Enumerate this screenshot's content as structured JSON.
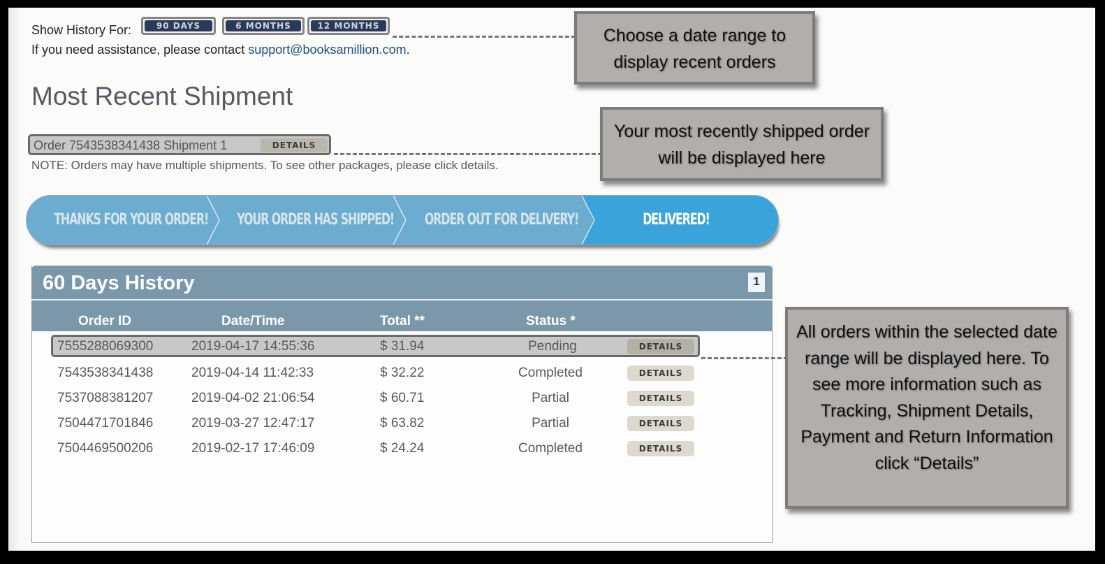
{
  "history_bar": {
    "label": "Show History For:",
    "buttons": [
      "90 DAYS",
      "6 MONTHS",
      "12 MONTHS"
    ]
  },
  "assistance": {
    "prefix": "If you need assistance, please contact ",
    "email": "support@booksamillion.com",
    "suffix": "."
  },
  "recent_shipment": {
    "title": "Most Recent Shipment",
    "order_text": "Order 7543538341438 Shipment 1",
    "details_label": "DETAILS",
    "note": "NOTE: Orders may have multiple shipments. To see other packages, please click details."
  },
  "progress": {
    "steps": [
      "THANKS FOR YOUR ORDER!",
      "YOUR ORDER HAS SHIPPED!",
      "ORDER OUT FOR DELIVERY!",
      "DELIVERED!"
    ],
    "current_step": "DELIVERED!",
    "colors": {
      "inactive": "#6baccf",
      "active": "#3aa3d9"
    }
  },
  "history_panel": {
    "title": "60 Days History",
    "page": "1",
    "columns": [
      "Order ID",
      "Date/Time",
      "Total **",
      "Status *"
    ],
    "details_label": "DETAILS",
    "rows": [
      {
        "order_id": "7555288069300",
        "datetime": "2019-04-17 14:55:36",
        "total": "$ 31.94",
        "status": "Pending",
        "highlighted": true
      },
      {
        "order_id": "7543538341438",
        "datetime": "2019-04-14 11:42:33",
        "total": "$ 32.22",
        "status": "Completed"
      },
      {
        "order_id": "7537088381207",
        "datetime": "2019-04-02 21:06:54",
        "total": "$ 60.71",
        "status": "Partial"
      },
      {
        "order_id": "7504471701846",
        "datetime": "2019-03-27 12:47:17",
        "total": "$ 63.82",
        "status": "Partial"
      },
      {
        "order_id": "7504469500206",
        "datetime": "2019-02-17 17:46:09",
        "total": "$ 24.24",
        "status": "Completed"
      }
    ],
    "header_color": "#7b98aa"
  },
  "callouts": {
    "date_range": "Choose a date range to display recent orders",
    "recent": "Your most recently shipped order will be displayed here",
    "orders": "All orders within the selected date range will be displayed here. To see more information such as Tracking, Shipment Details, Payment and Return Information click “Details”"
  }
}
